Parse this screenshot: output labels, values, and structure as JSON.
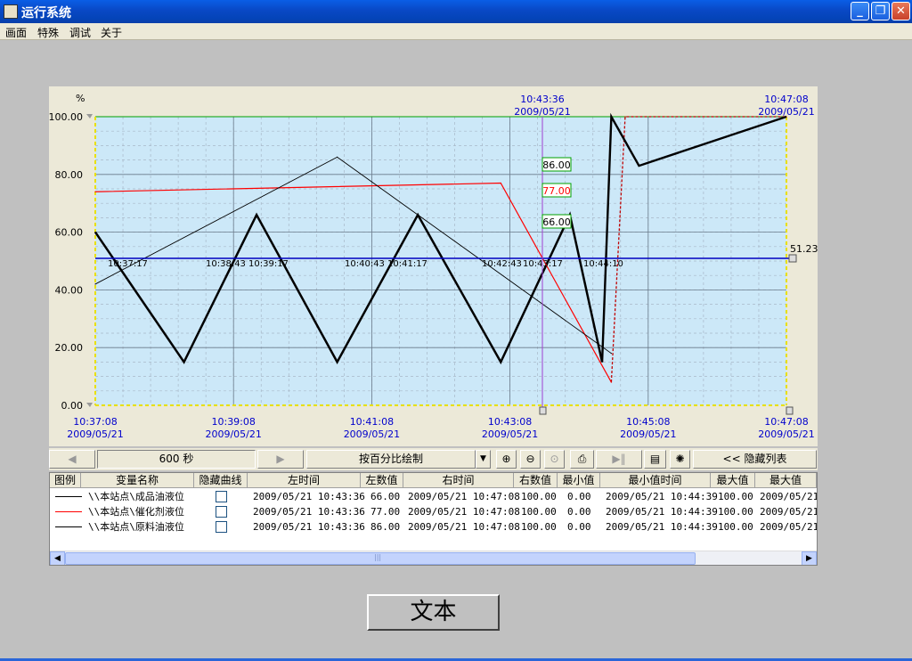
{
  "window": {
    "title": "运行系统",
    "minimize_icon": "minimize-icon",
    "restore_icon": "restore-icon",
    "close_icon": "close-icon",
    "minimize_glyph": "_",
    "restore_glyph": "❐",
    "close_glyph": "✕"
  },
  "menu": [
    "画面",
    "特殊",
    "调试",
    "关于"
  ],
  "chart": {
    "y_unit": "%",
    "y_ticks": [
      "100.00",
      "80.00",
      "60.00",
      "40.00",
      "20.00",
      "0.00"
    ],
    "x_ticks": [
      {
        "time": "10:37:08",
        "date": "2009/05/21"
      },
      {
        "time": "10:39:08",
        "date": "2009/05/21"
      },
      {
        "time": "10:41:08",
        "date": "2009/05/21"
      },
      {
        "time": "10:43:08",
        "date": "2009/05/21"
      },
      {
        "time": "10:45:08",
        "date": "2009/05/21"
      },
      {
        "time": "10:47:08",
        "date": "2009/05/21"
      }
    ],
    "cursor_top": {
      "time": "10:43:36",
      "date": "2009/05/21"
    },
    "right_top": {
      "time": "10:47:08",
      "date": "2009/05/21"
    },
    "cursor_values": [
      "86.00",
      "77.00",
      "66.00"
    ],
    "hline_value": "51.23",
    "hline_times": [
      "10:37:17",
      "10:38:43",
      "10:39:17",
      "10:40:43",
      "10:41:17",
      "10:42:43",
      "10:43:17",
      "10:44:10"
    ],
    "colors": {
      "plot_bg": "#cce8f8",
      "series1": "#000000",
      "series2": "#ff0000",
      "series3": "#000000",
      "cursor": "#a040d0",
      "hline": "#0000c0",
      "axis_label": "#0000cc"
    }
  },
  "chart_data": {
    "type": "line",
    "ylim": [
      0,
      100
    ],
    "y_unit": "%",
    "x_range": [
      "10:37:08",
      "10:47:08"
    ],
    "series": [
      {
        "name": "\\\\本站点\\成品油液位",
        "x": [
          "10:37:08",
          "10:38:25",
          "10:39:28",
          "10:40:38",
          "10:41:48",
          "10:43:00",
          "10:44:00",
          "10:44:28"
        ],
        "values": [
          60,
          15,
          66,
          15,
          66,
          15,
          66,
          15
        ]
      },
      {
        "name": "\\\\本站点\\催化剂液位",
        "x": [
          "10:37:08",
          "10:43:00",
          "10:44:36",
          "10:44:48",
          "10:47:08"
        ],
        "values": [
          74,
          77,
          8,
          100,
          100
        ]
      },
      {
        "name": "\\\\本站点\\原料油液位",
        "x": [
          "10:37:08",
          "10:40:38",
          "10:44:36"
        ],
        "values": [
          42,
          86,
          18
        ]
      }
    ]
  },
  "toolbar": {
    "prev_glyph": "◀",
    "period": "600 秒",
    "next_glyph": "▶",
    "mode": "按百分比绘制",
    "dropdown_glyph": "▼",
    "zoom_in_glyph": "⊕",
    "zoom_out_glyph": "⊖",
    "zoom_reset_glyph": "⊙",
    "print_glyph": "⎙",
    "play_glyph": "▶‖",
    "list_glyph": "▤",
    "settings_glyph": "✺",
    "hide_list": "<< 隐藏列表"
  },
  "table": {
    "headers": [
      "图例",
      "变量名称",
      "隐藏曲线",
      "左时间",
      "左数值",
      "右时间",
      "右数值",
      "最小值",
      "最小值时间",
      "最大值",
      "最大值"
    ],
    "rows": [
      {
        "color": "#000000",
        "name": "\\\\本站点\\成品油液位",
        "left_time": "2009/05/21 10:43:36",
        "left_value": "66.00",
        "right_time": "2009/05/21 10:47:08",
        "right_value": "100.00",
        "min": "0.00",
        "min_time": "2009/05/21 10:44:39",
        "max": "100.00",
        "max_time": "2009/05/21"
      },
      {
        "color": "#ff0000",
        "name": "\\\\本站点\\催化剂液位",
        "left_time": "2009/05/21 10:43:36",
        "left_value": "77.00",
        "right_time": "2009/05/21 10:47:08",
        "right_value": "100.00",
        "min": "0.00",
        "min_time": "2009/05/21 10:44:39",
        "max": "100.00",
        "max_time": "2009/05/21"
      },
      {
        "color": "#000000",
        "name": "\\\\本站点\\原料油液位",
        "left_time": "2009/05/21 10:43:36",
        "left_value": "86.00",
        "right_time": "2009/05/21 10:47:08",
        "right_value": "100.00",
        "min": "0.00",
        "min_time": "2009/05/21 10:44:39",
        "max": "100.00",
        "max_time": "2009/05/21"
      }
    ],
    "scroll_left": "◀",
    "scroll_right": "▶",
    "scroll_grip": "|||"
  },
  "text_button": "文本"
}
